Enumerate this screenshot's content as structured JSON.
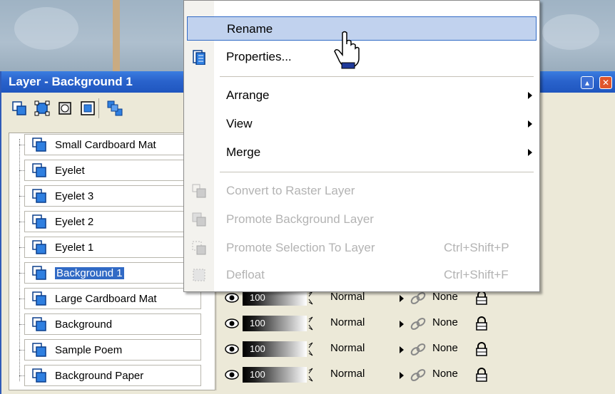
{
  "window": {
    "title": "Layer - Background 1"
  },
  "toolbar": {
    "icons": [
      "new-raster-layer-icon",
      "new-vector-layer-icon",
      "new-mask-layer-icon",
      "new-adjustment-layer-icon",
      "layer-group-icon"
    ]
  },
  "layers": [
    {
      "name": "Small Cardboard Mat",
      "selected": false
    },
    {
      "name": "Eyelet",
      "selected": false
    },
    {
      "name": "Eyelet 3",
      "selected": false
    },
    {
      "name": "Eyelet 2",
      "selected": false
    },
    {
      "name": "Eyelet 1",
      "selected": false
    },
    {
      "name": "Background 1",
      "selected": true
    },
    {
      "name": "Large Cardboard Mat",
      "selected": false
    },
    {
      "name": "Background",
      "selected": false
    },
    {
      "name": "Sample Poem",
      "selected": false
    },
    {
      "name": "Background Paper",
      "selected": false
    }
  ],
  "layer_props": [
    {
      "opacity": "100",
      "blend": "Normal",
      "link": "None"
    },
    {
      "opacity": "100",
      "blend": "Normal",
      "link": "None"
    },
    {
      "opacity": "100",
      "blend": "Normal",
      "link": "None"
    },
    {
      "opacity": "100",
      "blend": "Normal",
      "link": "None"
    }
  ],
  "context_menu": {
    "items": [
      {
        "label": "Rename",
        "state": "hover"
      },
      {
        "label": "Properties...",
        "icon": "properties-icon"
      },
      {
        "label": "Arrange",
        "submenu": true
      },
      {
        "label": "View",
        "submenu": true
      },
      {
        "label": "Merge",
        "submenu": true
      },
      {
        "label": "Convert to Raster Layer",
        "disabled": true,
        "icon": "convert-raster-icon"
      },
      {
        "label": "Promote Background Layer",
        "disabled": true,
        "icon": "promote-background-icon"
      },
      {
        "label": "Promote Selection To Layer",
        "disabled": true,
        "shortcut": "Ctrl+Shift+P",
        "icon": "promote-selection-icon"
      },
      {
        "label": "Defloat",
        "disabled": true,
        "shortcut": "Ctrl+Shift+F",
        "icon": "defloat-icon"
      }
    ]
  },
  "colors": {
    "titlebar": "#2a63cc",
    "selection": "#316ac5",
    "menu_hover": "#c1d2ee",
    "disabled_text": "#b3b3b3"
  }
}
